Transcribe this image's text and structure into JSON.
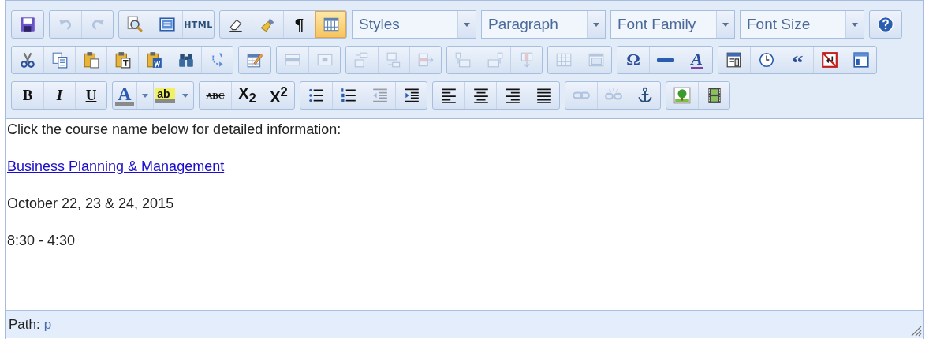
{
  "toolbars": [
    {
      "groups": [
        {
          "kind": "buttons",
          "buttons": [
            {
              "kind": "save",
              "disabled": false,
              "active": false
            }
          ]
        },
        {
          "kind": "buttons",
          "buttons": [
            {
              "kind": "undo",
              "disabled": true,
              "active": false
            },
            {
              "kind": "redo",
              "disabled": true,
              "active": false
            }
          ]
        },
        {
          "kind": "buttons",
          "buttons": [
            {
              "kind": "preview",
              "disabled": false,
              "active": false
            },
            {
              "kind": "fullpage",
              "disabled": false,
              "active": false
            },
            {
              "kind": "code",
              "label": "HTML",
              "disabled": false,
              "active": false
            }
          ]
        },
        {
          "kind": "buttons",
          "buttons": [
            {
              "kind": "cleanup",
              "disabled": false,
              "active": false
            },
            {
              "kind": "removeformat",
              "disabled": false,
              "active": false
            },
            {
              "kind": "visualchars",
              "label": "¶",
              "disabled": false,
              "active": false
            },
            {
              "kind": "visualaid",
              "disabled": false,
              "active": true
            }
          ]
        },
        {
          "kind": "listbox",
          "label": "Styles"
        },
        {
          "kind": "listbox",
          "label": "Paragraph"
        },
        {
          "kind": "listbox",
          "label": "Font Family"
        },
        {
          "kind": "listbox",
          "label": "Font Size"
        },
        {
          "kind": "buttons",
          "buttons": [
            {
              "kind": "help",
              "disabled": false,
              "active": false
            }
          ]
        }
      ]
    },
    {
      "groups": [
        {
          "kind": "buttons",
          "buttons": [
            {
              "kind": "cut",
              "disabled": false,
              "active": false
            },
            {
              "kind": "copy",
              "disabled": false,
              "active": false
            },
            {
              "kind": "paste",
              "disabled": false,
              "active": false
            },
            {
              "kind": "pastetext",
              "disabled": false,
              "active": false
            },
            {
              "kind": "pasteword",
              "disabled": false,
              "active": false
            },
            {
              "kind": "search",
              "disabled": false,
              "active": false
            },
            {
              "kind": "replace",
              "disabled": false,
              "active": false
            }
          ]
        },
        {
          "kind": "buttons",
          "buttons": [
            {
              "kind": "table",
              "disabled": false,
              "active": false
            }
          ]
        },
        {
          "kind": "buttons",
          "buttons": [
            {
              "kind": "row_props",
              "disabled": true,
              "active": false
            },
            {
              "kind": "cell_props",
              "disabled": true,
              "active": false
            }
          ]
        },
        {
          "kind": "buttons",
          "buttons": [
            {
              "kind": "row_before",
              "disabled": true,
              "active": false
            },
            {
              "kind": "row_after",
              "disabled": true,
              "active": false
            },
            {
              "kind": "delete_row",
              "disabled": true,
              "active": false
            }
          ]
        },
        {
          "kind": "buttons",
          "buttons": [
            {
              "kind": "col_before",
              "disabled": true,
              "active": false
            },
            {
              "kind": "col_after",
              "disabled": true,
              "active": false
            },
            {
              "kind": "delete_col",
              "disabled": true,
              "active": false
            }
          ]
        },
        {
          "kind": "buttons",
          "buttons": [
            {
              "kind": "split_cells",
              "disabled": true,
              "active": false
            },
            {
              "kind": "merge_cells",
              "disabled": true,
              "active": false
            }
          ]
        },
        {
          "kind": "buttons",
          "buttons": [
            {
              "kind": "charmap",
              "label": "Ω",
              "disabled": false,
              "active": false
            },
            {
              "kind": "hr",
              "disabled": false,
              "active": false
            },
            {
              "kind": "styleprops",
              "label": "A",
              "disabled": false,
              "active": false
            }
          ]
        },
        {
          "kind": "buttons",
          "buttons": [
            {
              "kind": "insertdate",
              "disabled": false,
              "active": false
            },
            {
              "kind": "inserttime",
              "disabled": false,
              "active": false
            },
            {
              "kind": "blockquote",
              "label": "“",
              "disabled": false,
              "active": false
            },
            {
              "kind": "nonbreaking",
              "disabled": false,
              "active": false
            },
            {
              "kind": "template",
              "disabled": false,
              "active": false
            }
          ]
        }
      ]
    },
    {
      "groups": [
        {
          "kind": "buttons",
          "buttons": [
            {
              "kind": "bold",
              "label": "B",
              "disabled": false,
              "active": false
            },
            {
              "kind": "italic",
              "label": "I",
              "disabled": false,
              "active": false
            },
            {
              "kind": "underline",
              "label": "U",
              "disabled": false,
              "active": false
            }
          ]
        },
        {
          "kind": "buttons",
          "buttons": [
            {
              "kind": "forecolor",
              "label": "A",
              "split": true,
              "disabled": false,
              "active": false
            },
            {
              "kind": "backcolor",
              "label": "ab",
              "split": true,
              "disabled": false,
              "active": false
            }
          ]
        },
        {
          "kind": "buttons",
          "buttons": [
            {
              "kind": "strikethrough",
              "label": "ABC",
              "disabled": false,
              "active": false
            },
            {
              "kind": "sub",
              "label": "X$_{2}$",
              "disabled": false,
              "active": false
            },
            {
              "kind": "sup",
              "label": "X$^{2}$",
              "disabled": false,
              "active": false
            }
          ]
        },
        {
          "kind": "buttons",
          "buttons": [
            {
              "kind": "bullist",
              "disabled": false,
              "active": false
            },
            {
              "kind": "numlist",
              "disabled": false,
              "active": false
            },
            {
              "kind": "outdent",
              "disabled": true,
              "active": false
            },
            {
              "kind": "indent",
              "disabled": false,
              "active": false
            }
          ]
        },
        {
          "kind": "buttons",
          "buttons": [
            {
              "kind": "justifyleft",
              "disabled": false,
              "active": false
            },
            {
              "kind": "justifycenter",
              "disabled": false,
              "active": false
            },
            {
              "kind": "justifyright",
              "disabled": false,
              "active": false
            },
            {
              "kind": "justifyfull",
              "disabled": false,
              "active": false
            }
          ]
        },
        {
          "kind": "buttons",
          "buttons": [
            {
              "kind": "link",
              "disabled": true,
              "active": false
            },
            {
              "kind": "unlink",
              "disabled": true,
              "active": false
            },
            {
              "kind": "anchor",
              "disabled": false,
              "active": false
            }
          ]
        },
        {
          "kind": "buttons",
          "buttons": [
            {
              "kind": "image",
              "disabled": false,
              "active": false
            },
            {
              "kind": "media",
              "disabled": false,
              "active": false
            }
          ]
        }
      ]
    }
  ],
  "content": {
    "paragraphs": [
      {
        "kind": "text",
        "text": "Click the course name below for detailed information:"
      },
      {
        "kind": "link",
        "text": "Business Planning & Management"
      },
      {
        "kind": "text",
        "text": "October 22, 23 & 24, 2015"
      },
      {
        "kind": "text",
        "text": "8:30 - 4:30"
      }
    ]
  },
  "status_bar": {
    "label": "Path:",
    "path": "p"
  }
}
